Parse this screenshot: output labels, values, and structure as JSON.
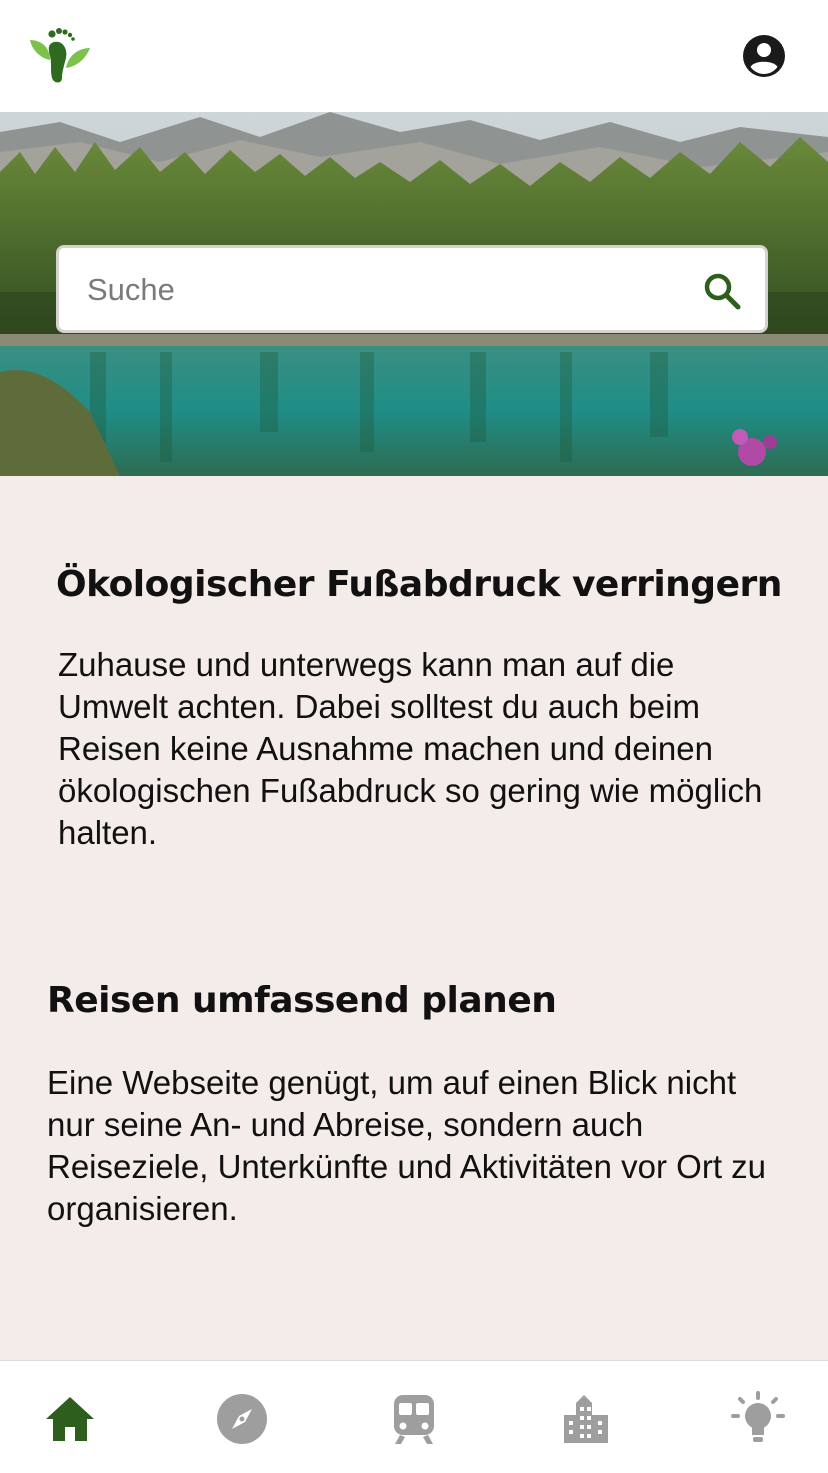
{
  "header": {
    "logo_icon": "footprint-leaf-logo",
    "profile_icon": "account-circle-icon",
    "brand_color": "#2e6b1f"
  },
  "search": {
    "placeholder": "Suche",
    "icon": "search-icon"
  },
  "sections": [
    {
      "title": "Ökologischer Fußabdruck verringern",
      "text": "Zuhause und unterwegs kann man auf die Umwelt achten. Dabei solltest du auch beim Reisen keine Ausnahme machen und deinen ökologischen Fußabdruck so gering wie möglich halten."
    },
    {
      "title": "Reisen umfassend planen",
      "text": "Eine Webseite genügt, um auf einen Blick nicht nur seine An- und Abreise, sondern auch Reiseziele, Unterkünfte und Aktivitäten vor Ort zu organisieren."
    }
  ],
  "bottom_nav": {
    "items": [
      {
        "icon": "home-icon",
        "active": true
      },
      {
        "icon": "compass-icon",
        "active": false
      },
      {
        "icon": "train-icon",
        "active": false
      },
      {
        "icon": "building-icon",
        "active": false
      },
      {
        "icon": "lightbulb-icon",
        "active": false
      }
    ],
    "active_color": "#2e5e1e",
    "inactive_color": "#9e9e9e"
  }
}
